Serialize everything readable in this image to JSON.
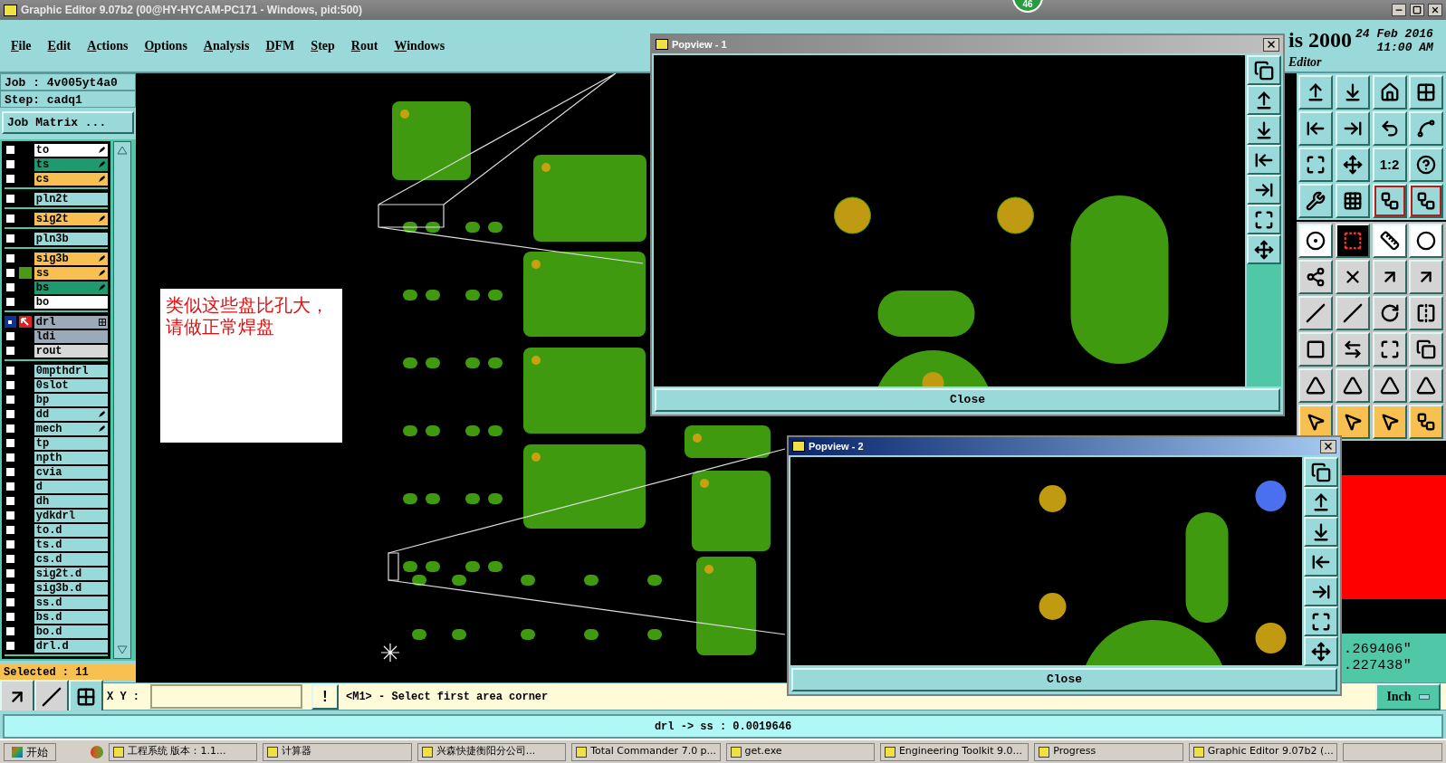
{
  "window": {
    "title": "Graphic Editor 9.07b2 (00@HY-HYCAM-PC171 - Windows, pid:500)",
    "notification_badge": "46"
  },
  "menu": [
    "File",
    "Edit",
    "Actions",
    "Options",
    "Analysis",
    "DFM",
    "Step",
    "Rout",
    "Windows"
  ],
  "branding": {
    "product": "is 2000",
    "subtitle": "Editor",
    "date": "24 Feb 2016",
    "time": "11:00 AM"
  },
  "job": {
    "job": "Job : 4v005yt4a0",
    "step": "Step: cadq1",
    "matrix_button": "Job Matrix ..."
  },
  "layer_groups": [
    [
      {
        "name": "to",
        "color": "#ffffff",
        "selected": false,
        "shown": false,
        "edit_mark": true
      },
      {
        "name": "ts",
        "color": "#1f9a70",
        "selected": false,
        "shown": false,
        "edit_mark": true
      },
      {
        "name": "cs",
        "color": "#f8c050",
        "selected": false,
        "shown": false,
        "edit_mark": true
      }
    ],
    [
      {
        "name": "pln2t",
        "color": "#9ad9d9",
        "selected": false,
        "shown": false,
        "edit_mark": false
      }
    ],
    [
      {
        "name": "sig2t",
        "color": "#f8c050",
        "selected": false,
        "shown": false,
        "edit_mark": true
      }
    ],
    [
      {
        "name": "pln3b",
        "color": "#9ad9d9",
        "selected": false,
        "shown": false,
        "edit_mark": false
      }
    ],
    [
      {
        "name": "sig3b",
        "color": "#f8c050",
        "selected": false,
        "shown": false,
        "edit_mark": true
      },
      {
        "name": "ss",
        "color": "#f8c050",
        "selected": false,
        "shown": true,
        "edit_mark": true
      },
      {
        "name": "bs",
        "color": "#1f9a70",
        "selected": false,
        "shown": false,
        "edit_mark": true
      },
      {
        "name": "bo",
        "color": "#ffffff",
        "selected": false,
        "shown": false,
        "edit_mark": false
      }
    ],
    [
      {
        "name": "drl",
        "color": "#9aaab8",
        "selected": true,
        "shown": false,
        "edit_mark": false,
        "grid_mark": true
      },
      {
        "name": "ldi",
        "color": "#9aaab8",
        "selected": false,
        "shown": false,
        "edit_mark": false
      },
      {
        "name": "rout",
        "color": "#d8d8d8",
        "selected": false,
        "shown": false,
        "edit_mark": false
      }
    ],
    [
      {
        "name": "0mpthdrl",
        "color": "#9ad9d9",
        "selected": false,
        "shown": false,
        "edit_mark": false
      },
      {
        "name": "0slot",
        "color": "#9ad9d9",
        "selected": false,
        "shown": false,
        "edit_mark": false
      },
      {
        "name": "bp",
        "color": "#9ad9d9",
        "selected": false,
        "shown": false,
        "edit_mark": false
      },
      {
        "name": "dd",
        "color": "#9ad9d9",
        "selected": false,
        "shown": false,
        "edit_mark": true
      },
      {
        "name": "mech",
        "color": "#9ad9d9",
        "selected": false,
        "shown": false,
        "edit_mark": true
      },
      {
        "name": "tp",
        "color": "#9ad9d9",
        "selected": false,
        "shown": false,
        "edit_mark": false
      },
      {
        "name": "npth",
        "color": "#9ad9d9",
        "selected": false,
        "shown": false,
        "edit_mark": false
      },
      {
        "name": "cvia",
        "color": "#9ad9d9",
        "selected": false,
        "shown": false,
        "edit_mark": false
      },
      {
        "name": "d",
        "color": "#9ad9d9",
        "selected": false,
        "shown": false,
        "edit_mark": false
      },
      {
        "name": "dh",
        "color": "#9ad9d9",
        "selected": false,
        "shown": false,
        "edit_mark": false
      },
      {
        "name": "ydkdrl",
        "color": "#9ad9d9",
        "selected": false,
        "shown": false,
        "edit_mark": false
      },
      {
        "name": "to.d",
        "color": "#9ad9d9",
        "selected": false,
        "shown": false,
        "edit_mark": false
      },
      {
        "name": "ts.d",
        "color": "#9ad9d9",
        "selected": false,
        "shown": false,
        "edit_mark": false
      },
      {
        "name": "cs.d",
        "color": "#9ad9d9",
        "selected": false,
        "shown": false,
        "edit_mark": false
      },
      {
        "name": "sig2t.d",
        "color": "#9ad9d9",
        "selected": false,
        "shown": false,
        "edit_mark": false
      },
      {
        "name": "sig3b.d",
        "color": "#9ad9d9",
        "selected": false,
        "shown": false,
        "edit_mark": false
      },
      {
        "name": "ss.d",
        "color": "#9ad9d9",
        "selected": false,
        "shown": false,
        "edit_mark": false
      },
      {
        "name": "bs.d",
        "color": "#9ad9d9",
        "selected": false,
        "shown": false,
        "edit_mark": false
      },
      {
        "name": "bo.d",
        "color": "#9ad9d9",
        "selected": false,
        "shown": false,
        "edit_mark": false
      },
      {
        "name": "drl.d",
        "color": "#9ad9d9",
        "selected": false,
        "shown": false,
        "edit_mark": false
      }
    ]
  ],
  "selected_count": "Selected : 11",
  "annotation": "类似这些盘比孔大，请做正常焊盘",
  "toolbar": {
    "ratio_label": "1:2",
    "snap_toggles": [
      {
        "on": true
      },
      {
        "on": true
      }
    ]
  },
  "coordinates": [
    ".269406\"",
    ".227438\""
  ],
  "command_line": {
    "xy_label": "X Y :",
    "confirm": "!",
    "message": "<M1> - Select first area corner",
    "units": "Inch"
  },
  "status": "drl -> ss : 0.0019646",
  "popviews": [
    {
      "title": "Popview - 1",
      "active": false,
      "close_button": "Close"
    },
    {
      "title": "Popview - 2",
      "active": true,
      "close_button": "Close"
    }
  ],
  "taskbar": {
    "start": "开始",
    "tasks": [
      "工程系统  版本：1.1...",
      "计算器",
      "兴森快捷衡阳分公司...",
      "Total Commander 7.0 p...",
      "get.exe",
      "Engineering Toolkit 9.0...",
      "Progress",
      "Graphic Editor 9.07b2 (..."
    ]
  }
}
